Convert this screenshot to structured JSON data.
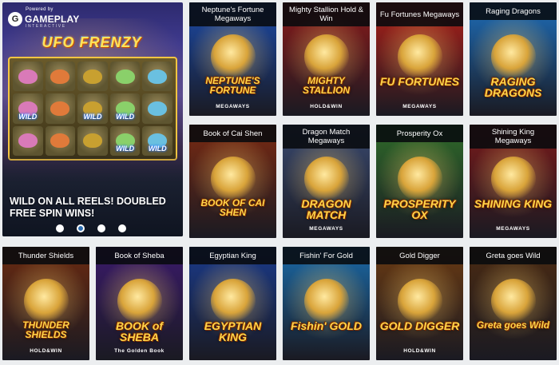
{
  "hero": {
    "powered_by": "Powered by",
    "brand_name": "GAMEPLAY",
    "brand_sub": "INTERACTIVE",
    "game_logo": "UFO FRENZY",
    "wild_label": "WILD",
    "promo_text": "WILD ON ALL REELS! DOUBLED FREE SPIN WINS!",
    "carousel_dots": 4,
    "active_dot": 2
  },
  "games": [
    {
      "title": "Neptune's Fortune Megaways",
      "logo": "NEPTUNE'S FORTUNE",
      "sub": "MEGAWAYS",
      "theme": "#1b4aa8"
    },
    {
      "title": "Mighty Stallion Hold & Win",
      "logo": "MIGHTY STALLION",
      "sub": "HOLD&WIN",
      "theme": "#8a1a1a"
    },
    {
      "title": "Fu Fortunes Megaways",
      "logo": "FU FORTUNES",
      "sub": "MEGAWAYS",
      "theme": "#b02018"
    },
    {
      "title": "Raging Dragons",
      "logo": "RAGING DRAGONS",
      "sub": "",
      "theme": "#1e6db8"
    },
    {
      "title": "Book of Cai Shen",
      "logo": "BOOK OF CAI SHEN",
      "sub": "",
      "theme": "#7a2a12"
    },
    {
      "title": "Dragon Match Megaways",
      "logo": "DRAGON MATCH",
      "sub": "MEGAWAYS",
      "theme": "#3a4a70"
    },
    {
      "title": "Prosperity Ox",
      "logo": "PROSPERITY OX",
      "sub": "",
      "theme": "#2f6b2a"
    },
    {
      "title": "Shining King Megaways",
      "logo": "SHINING KING",
      "sub": "MEGAWAYS",
      "theme": "#7a1a1a"
    },
    {
      "title": "Thunder Shields",
      "logo": "THUNDER SHIELDS",
      "sub": "HOLD&WIN",
      "theme": "#6a2a10"
    },
    {
      "title": "Book of Sheba",
      "logo": "BOOK of SHEBA",
      "sub": "The Golden Book",
      "theme": "#3a1a6a"
    },
    {
      "title": "Egyptian King",
      "logo": "EGYPTIAN KING",
      "sub": "",
      "theme": "#1a3a8a"
    },
    {
      "title": "Fishin' For Gold",
      "logo": "Fishin' GOLD",
      "sub": "",
      "theme": "#1a6aa8"
    },
    {
      "title": "Gold Digger",
      "logo": "GOLD DIGGER",
      "sub": "HOLD&WIN",
      "theme": "#6a3a12"
    },
    {
      "title": "Greta goes Wild",
      "logo": "Greta goes Wild",
      "sub": "",
      "theme": "#4a2a12"
    }
  ]
}
